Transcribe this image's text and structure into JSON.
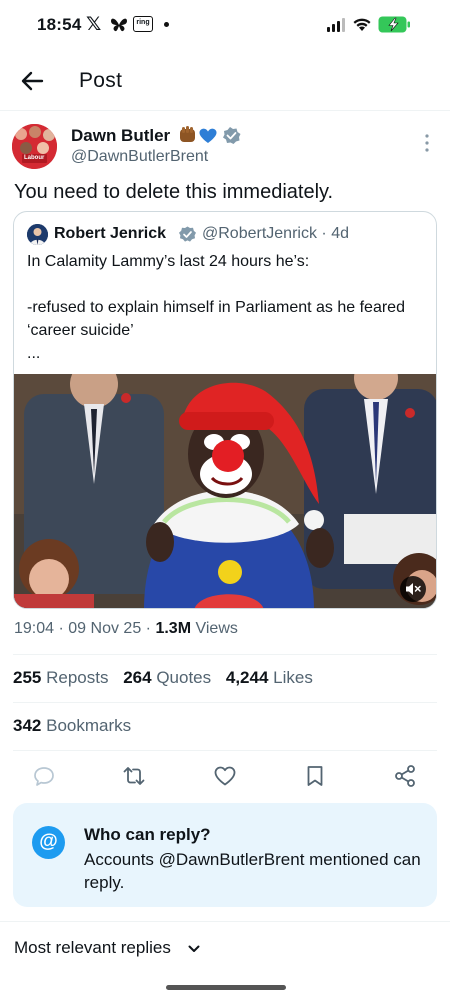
{
  "status_bar": {
    "time": "18:54",
    "x_glyph": "𝕏",
    "ring_label": "ring",
    "icons": [
      "x-icon",
      "butterfly-icon",
      "ring-icon",
      "dot-icon",
      "signal-icon",
      "wifi-icon",
      "battery-charging-icon"
    ]
  },
  "header": {
    "title": "Post",
    "back_icon": "arrow-left-icon"
  },
  "post": {
    "author_name": "Dawn Butler",
    "author_emoji": [
      "raised-fist-emoji",
      "blue-heart-emoji",
      "verified-badge"
    ],
    "author_handle": "@DawnButlerBrent",
    "text": "You need to delete this immediately.",
    "avatar_badge_text": "Labour",
    "quote": {
      "name": "Robert Jenrick",
      "handle": "@RobertJenrick",
      "separator": "·",
      "age": "4d",
      "body": "In Calamity Lammy’s last 24 hours he’s:\n\n-refused to explain himself in Parliament as he feared ‘career suicide’\n...",
      "media_icon": "mute-icon"
    },
    "meta": {
      "time": "19:04",
      "sep1": "·",
      "date": "09 Nov 25",
      "sep2": "·",
      "views_count": "1.3M",
      "views_label": "Views"
    },
    "stats": {
      "reposts_count": "255",
      "reposts_label": "Reposts",
      "quotes_count": "264",
      "quotes_label": "Quotes",
      "likes_count": "4,244",
      "likes_label": "Likes",
      "bookmarks_count": "342",
      "bookmarks_label": "Bookmarks"
    },
    "actions": [
      "reply-icon",
      "repost-icon",
      "like-icon",
      "bookmark-icon",
      "share-icon"
    ]
  },
  "who_can_reply": {
    "icon_glyph": "@",
    "title": "Who can reply?",
    "description": "Accounts @DawnButlerBrent mentioned can reply."
  },
  "replies_sort": {
    "label": "Most relevant replies"
  },
  "colors": {
    "accent": "#1d9bf0",
    "text": "#0f1419",
    "secondary": "#536471",
    "reply_box_bg": "#e8f5fd",
    "battery": "#34c759"
  }
}
